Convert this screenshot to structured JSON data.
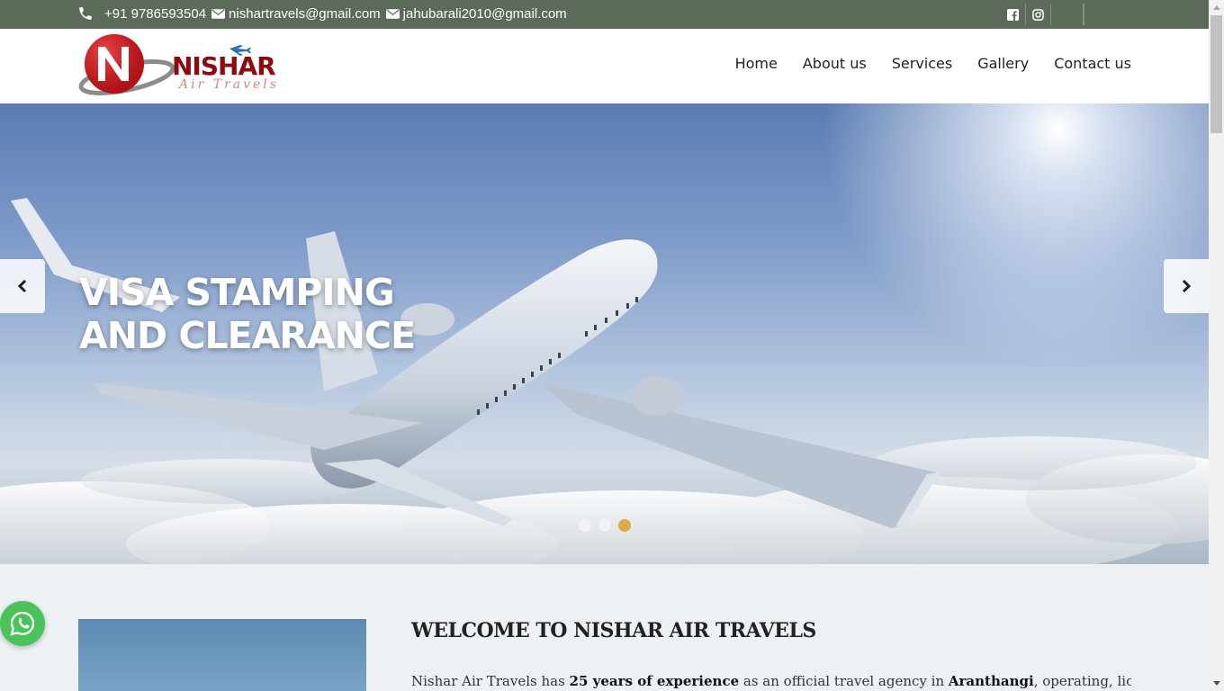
{
  "topbar": {
    "phone": "+91 9786593504",
    "email1": "nishartravels@gmail.com",
    "email2": "jahubarali2010@gmail.com"
  },
  "logo": {
    "name": "NISHAR",
    "tagline": "Air Travels"
  },
  "nav": {
    "items": [
      {
        "label": "Home"
      },
      {
        "label": "About us"
      },
      {
        "label": "Services"
      },
      {
        "label": "Gallery"
      },
      {
        "label": "Contact us"
      }
    ]
  },
  "hero": {
    "title_line1": "VISA STAMPING",
    "title_line2": "AND CLEARANCE",
    "slide_count": 3,
    "active_slide": 3
  },
  "welcome": {
    "title": "WELCOME TO NISHAR AIR TRAVELS",
    "text_part1": "Nishar Air Travels has ",
    "text_bold1": "25 years of experience",
    "text_part2": " as an official travel agency in ",
    "text_bold2": "Aranthangi",
    "text_part3": ", operating, licensed,"
  },
  "colors": {
    "topbar": "#5b6a59",
    "accent_dot": "#e0aa48",
    "whatsapp": "#4cc25a",
    "logo_red": "#c8151c"
  }
}
